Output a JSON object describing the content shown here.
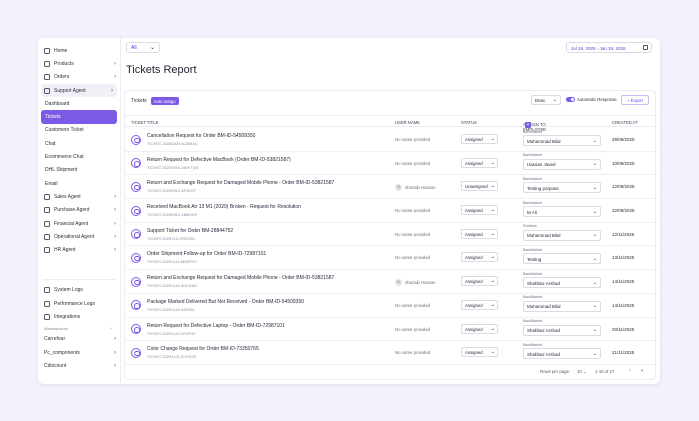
{
  "sidebar": {
    "items": [
      {
        "label": "Home",
        "icon": "home-icon",
        "chevron": false
      },
      {
        "label": "Products",
        "icon": "box-icon",
        "chevron": true
      },
      {
        "label": "Orders",
        "icon": "cart-icon",
        "chevron": true
      },
      {
        "label": "Support Agent",
        "icon": "headset-icon",
        "chevron": true,
        "state": "parent-active"
      },
      {
        "label": "Dashboard",
        "sub": true
      },
      {
        "label": "Tickets",
        "sub": true,
        "state": "active"
      },
      {
        "label": "Customers Ticket",
        "sub": true
      },
      {
        "label": "Chat",
        "sub": true
      },
      {
        "label": "Ecommerce Chat",
        "sub": true
      },
      {
        "label": "DHL Shipment",
        "sub": true
      },
      {
        "label": "Email",
        "sub": true
      },
      {
        "label": "Sales Agent",
        "icon": "sales-icon",
        "chevron": true
      },
      {
        "label": "Purchase Agent",
        "icon": "purchase-icon",
        "chevron": true
      },
      {
        "label": "Financial Agent",
        "icon": "finance-icon",
        "chevron": true
      },
      {
        "label": "Operational Agent",
        "icon": "gear-icon",
        "chevron": true
      },
      {
        "label": "HR Agent",
        "icon": "people-icon",
        "chevron": true
      }
    ],
    "bottom_items": [
      {
        "label": "System Logs",
        "icon": "log-icon"
      },
      {
        "label": "Performance Logs",
        "icon": "chart-icon"
      },
      {
        "label": "Integrations",
        "icon": "plug-icon"
      }
    ],
    "marketplace_label": "Marketplaces",
    "marketplace_plus": "+",
    "marketplaces": [
      {
        "label": "Carrefour"
      },
      {
        "label": "Pc_components"
      },
      {
        "label": "Cdiscount"
      }
    ]
  },
  "topbar": {
    "filter_value": "All",
    "date_range": "Jul 19, 2025 - Jan 19, 2026"
  },
  "page": {
    "title": "Tickets Report"
  },
  "card": {
    "label": "Tickets",
    "badge": "Auto assign",
    "sort_value": "Desc",
    "toggle_label": "Automatic Response",
    "toggle_on": true,
    "export_label": "+ Export"
  },
  "columns": {
    "title": "TICKET TITLE",
    "user": "USER NAME",
    "status": "STATUS",
    "assign": "ASSIGN TO EMPLOYEE",
    "created": "CREATED AT"
  },
  "tickets": [
    {
      "title": "Cancellation Request for Order BM-ID-54509350",
      "id": "TICKET-20250829-NZ5MAC",
      "user": "No name provided",
      "avatar": "",
      "status": "Assigned",
      "emp_label": "BackMarket",
      "employee": "Muhammad Bilal",
      "date": "29/08/2025"
    },
    {
      "title": "Return Request for Defective MacBook (Order BM-ID-53821587)",
      "id": "TICKET-20250910-4WYTQG",
      "user": "No name provided",
      "avatar": "",
      "status": "Assigned",
      "emp_label": "BackMarket",
      "employee": "Hassan Javed",
      "date": "10/09/2025"
    },
    {
      "title": "Return and Exchange Request for Damaged Mobile Phone - Order BM-ID-53821587",
      "id": "TICKET-20250912-5FJE1P",
      "user": "shazaib Hassan",
      "avatar": "S",
      "status": "Unassigned",
      "emp_label": "BackMarket",
      "employee": "Testing porpose",
      "date": "12/09/2025"
    },
    {
      "title": "Received MacBook Air 13 M1 (2020) Broken - Request for Resolution",
      "id": "TICKET-20250922-188KWX",
      "user": "No name provided",
      "avatar": "",
      "status": "Assigned",
      "emp_label": "BackMarket",
      "employee": "M Ali",
      "date": "22/09/2025"
    },
    {
      "title": "Support Ticket for Order BM-28844752",
      "id": "TICKET-20251112-RZ2X0L",
      "user": "No name provided",
      "avatar": "",
      "status": "Assigned",
      "emp_label": "Everflow",
      "employee": "Muhammad Bilal",
      "date": "12/11/2025"
    },
    {
      "title": "Order Shipment Follow-up for Order BM-ID-72987101",
      "id": "TICKET-20251113-M0NPVY",
      "user": "No name provided",
      "avatar": "",
      "status": "Assigned",
      "emp_label": "BackMarket",
      "employee": "Testing",
      "date": "13/11/2025"
    },
    {
      "title": "Return and Exchange Request for Damaged Mobile Phone - Order BM-ID-53821587",
      "id": "TICKET-20251114-8GCKAH",
      "user": "shazaib Hassan",
      "avatar": "S",
      "status": "Assigned",
      "emp_label": "BackMarket",
      "employee": "Shahbaz Arshad",
      "date": "14/11/2025"
    },
    {
      "title": "Package Marked Delivered But Not Received - Order BM-ID-54509350",
      "id": "TICKET-20251114-9J0J0U",
      "user": "No name provided",
      "avatar": "",
      "status": "Assigned",
      "emp_label": "BackMarket",
      "employee": "Muhammad Bilal",
      "date": "14/11/2025"
    },
    {
      "title": "Return Request for Defective Laptop - Order BM-ID-72987101",
      "id": "TICKET-20251120-9FVP4J",
      "user": "No name provided",
      "avatar": "",
      "status": "Assigned",
      "emp_label": "BackMarket",
      "employee": "Shahbaz Arshad",
      "date": "20/11/2025"
    },
    {
      "title": "Color Change Request for Order BM-ID-73350765",
      "id": "TICKET-20251121-EJYN3S",
      "user": "No name provided",
      "avatar": "",
      "status": "Assigned",
      "emp_label": "BackMarket",
      "employee": "Shahbaz Arshad",
      "date": "21/11/2025"
    }
  ],
  "pagination": {
    "rows_label": "Rows per page:",
    "rows_value": "10",
    "range": "1-10 of 27",
    "prev": "‹",
    "next": "›"
  }
}
